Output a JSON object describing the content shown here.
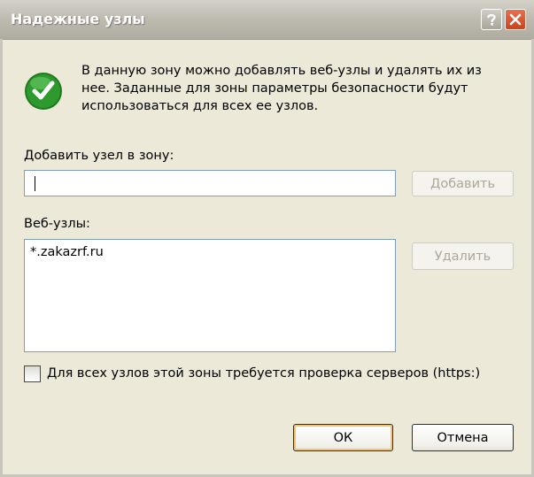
{
  "window": {
    "title": "Надежные узлы"
  },
  "info": {
    "icon": "check-icon",
    "text": "В данную зону можно добавлять веб-узлы и удалять их из нее. Заданные для зоны параметры безопасности будут использоваться для всех ее узлов."
  },
  "add_site": {
    "label": "Добавить узел в зону:",
    "input_value": "",
    "button_label": "Добавить"
  },
  "sites": {
    "label": "Веб-узлы:",
    "items": [
      "*.zakazrf.ru"
    ],
    "remove_label": "Удалить"
  },
  "require_https": {
    "label": "Для всех узлов этой зоны требуется проверка серверов (https:)",
    "checked": false
  },
  "footer": {
    "ok_label": "ОК",
    "cancel_label": "Отмена"
  },
  "colors": {
    "titlebar": "#bfbcb2",
    "close_button": "#d9532e",
    "check_icon": "#2e8b2e",
    "face": "#ece9d8"
  }
}
